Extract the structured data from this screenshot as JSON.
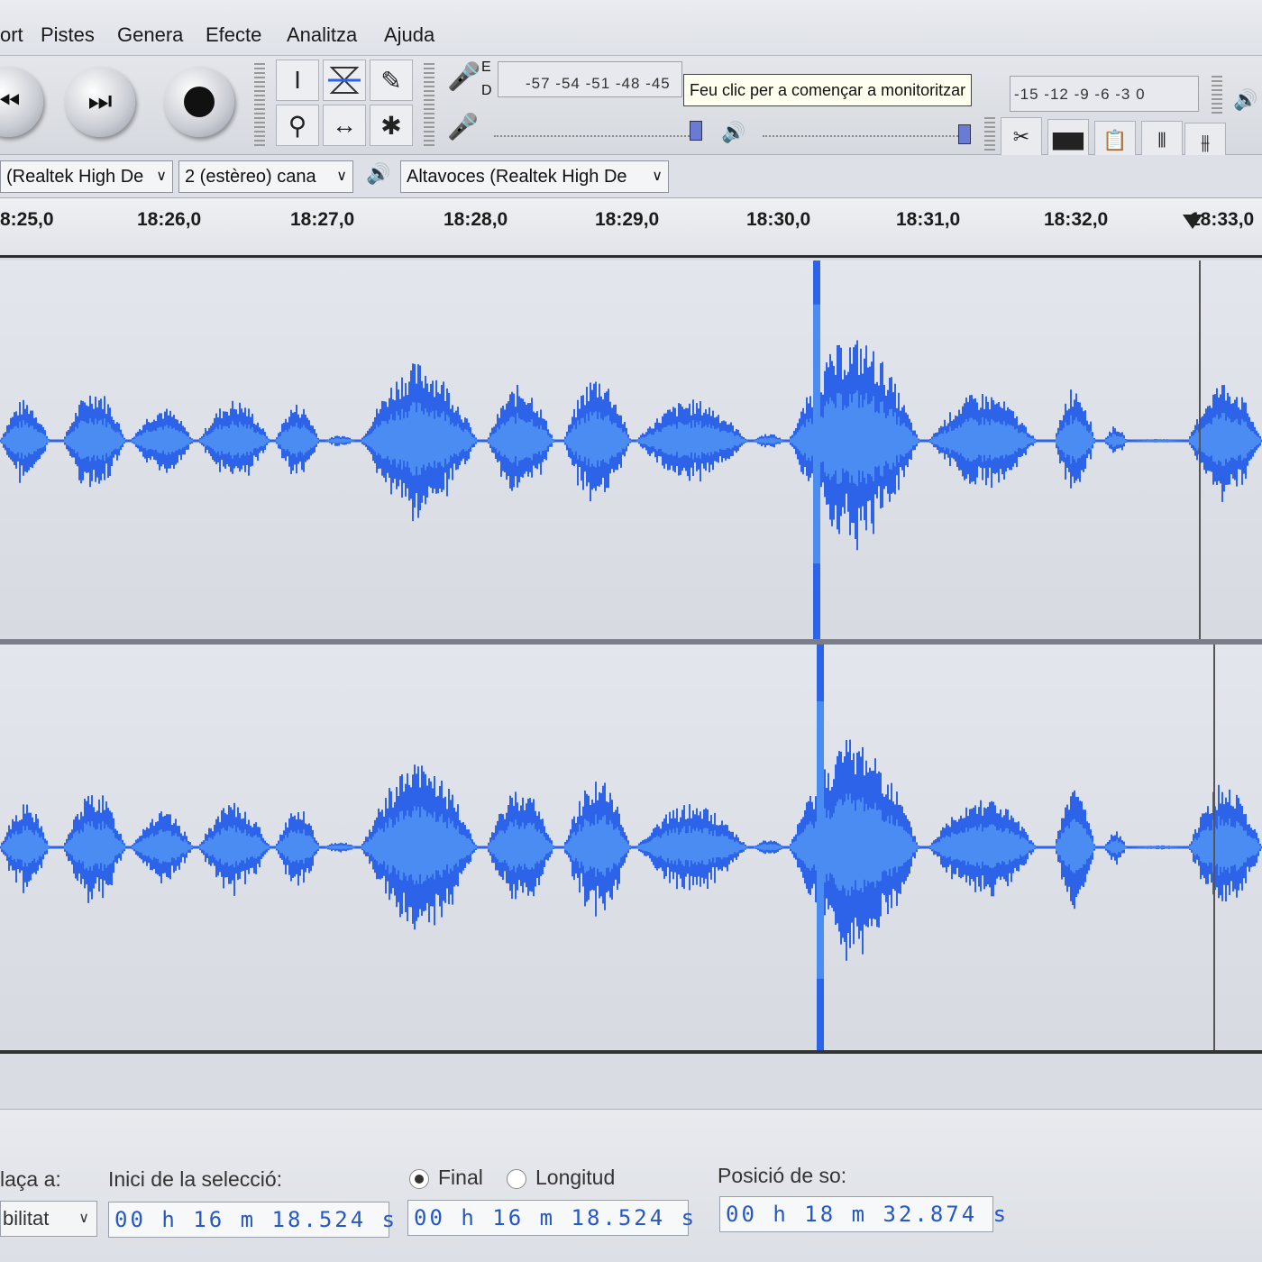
{
  "menu": [
    "ort",
    "Pistes",
    "Genera",
    "Efecte",
    "Analitza",
    "Ajuda"
  ],
  "transport": {
    "skip_start_icon": "skip-to-start-icon",
    "skip_end_icon": "skip-to-end-icon",
    "record_icon": "record-icon"
  },
  "tools": {
    "selection": "I",
    "envelope": "envelope-icon",
    "draw": "pencil-icon",
    "zoom": "zoom-icon",
    "timeshift": "↔",
    "multi": "✱"
  },
  "meters": {
    "record_channels": [
      "E",
      "D"
    ],
    "record_scale": "-57 -54 -51 -48 -45",
    "record_tooltip": "Feu clic per a començar a monitoritzar",
    "playback_scale": "-15 -12 -9 -6 -3 0"
  },
  "devices": {
    "input_device": "(Realtek High De",
    "channels": "2 (estèreo) cana",
    "output_device": "Altavoces (Realtek High De"
  },
  "ruler": {
    "labels": [
      "8:25,0",
      "18:26,0",
      "18:27,0",
      "18:28,0",
      "18:29,0",
      "18:30,0",
      "18:31,0",
      "18:32,0",
      "18:33,0"
    ]
  },
  "colors": {
    "waveform_dark": "#2d63e8",
    "waveform_light": "#4a8cf2",
    "background": "#dfe2e8"
  },
  "selection_bar": {
    "snap_label": "laça a:",
    "snap_value": "bilitat",
    "start_label": "Inici de la selecció:",
    "end_radio": "Final",
    "length_radio": "Longitud",
    "start_time": "00 h 16 m 18.524 s",
    "end_time": "00 h 16 m 18.524 s",
    "position_label": "Posició de so:",
    "position_time": "00 h 18 m 32.874 s"
  }
}
